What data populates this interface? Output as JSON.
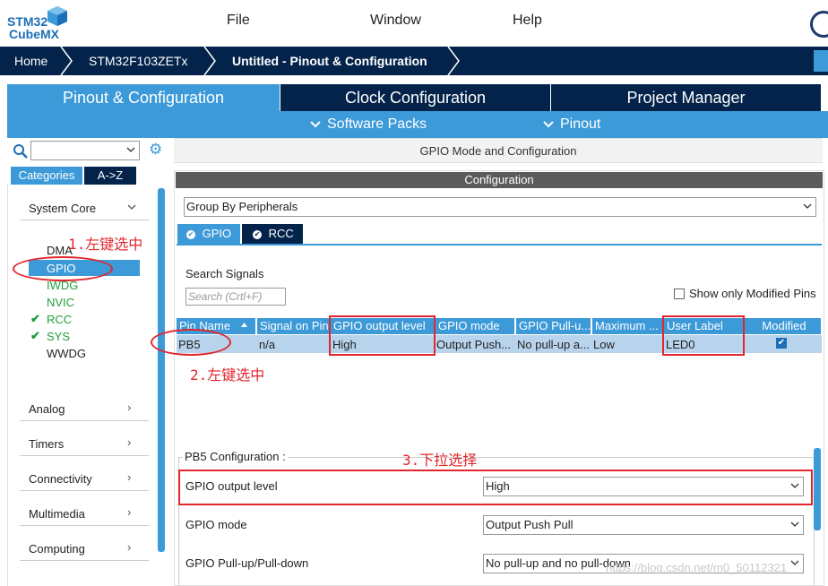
{
  "app": {
    "logo_top": "STM32",
    "logo_bottom": "CubeMX",
    "menu": [
      "File",
      "Window",
      "Help"
    ]
  },
  "breadcrumb": [
    "Home",
    "STM32F103ZETx",
    "Untitled - Pinout & Configuration"
  ],
  "main_tabs": [
    "Pinout & Configuration",
    "Clock Configuration",
    "Project Manager"
  ],
  "sub_menu": [
    "Software Packs",
    "Pinout"
  ],
  "left_panel": {
    "category_tabs": [
      "Categories",
      "A->Z"
    ],
    "categories": [
      "System Core",
      "Analog",
      "Timers",
      "Connectivity",
      "Multimedia",
      "Computing"
    ],
    "peripherals": [
      {
        "name": "DMA",
        "configured": false
      },
      {
        "name": "GPIO",
        "configured": false,
        "selected": true
      },
      {
        "name": "IWDG",
        "configured": false
      },
      {
        "name": "NVIC",
        "configured": false
      },
      {
        "name": "RCC",
        "configured": true
      },
      {
        "name": "SYS",
        "configured": true
      },
      {
        "name": "WWDG",
        "configured": false
      }
    ]
  },
  "right_panel": {
    "title": "GPIO Mode and Configuration",
    "config_header": "Configuration",
    "group_by": "Group By Peripherals",
    "peripheral_tabs": [
      "GPIO",
      "RCC"
    ],
    "search_label": "Search Signals",
    "search_placeholder": "Search (Crtl+F)",
    "show_modified": "Show only Modified Pins",
    "table": {
      "columns": [
        "Pin Name",
        "Signal on Pin",
        "GPIO output level",
        "GPIO mode",
        "GPIO Pull-u...",
        "Maximum ...",
        "User Label",
        "Modified"
      ],
      "rows": [
        [
          "PB5",
          "n/a",
          "High",
          "Output Push...",
          "No pull-up a...",
          "Low",
          "LED0",
          "✔"
        ]
      ]
    },
    "pin_config": {
      "title": "PB5 Configuration :",
      "fields": [
        {
          "label": "GPIO output level",
          "value": "High"
        },
        {
          "label": "GPIO mode",
          "value": "Output Push Pull"
        },
        {
          "label": "GPIO Pull-up/Pull-down",
          "value": "No pull-up and no pull-down"
        }
      ]
    }
  },
  "annotations": [
    "1.左键选中",
    "2.左键选中",
    "3.下拉选择"
  ],
  "watermark": "https://blog.csdn.net/m0_50112321",
  "colors": {
    "navy": "#03234b",
    "accent": "#3d9ad8",
    "annotation": "#e2262d",
    "ok": "#1f9e3b"
  }
}
